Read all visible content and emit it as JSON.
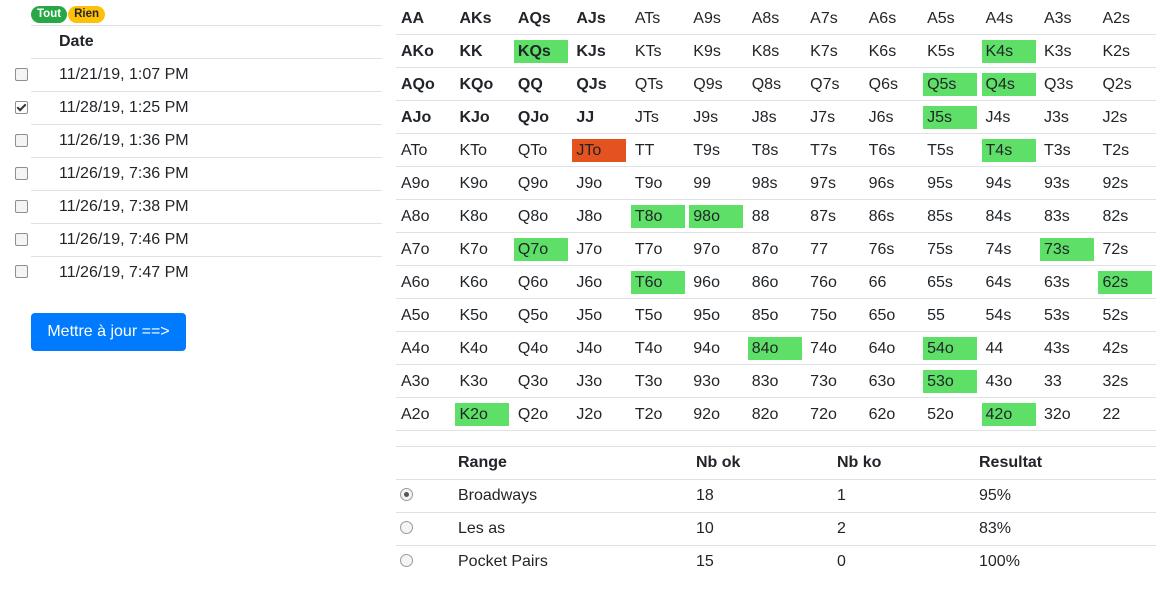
{
  "badges": {
    "all": "Tout",
    "none": "Rien"
  },
  "sessions": {
    "header": "Date",
    "rows": [
      {
        "date": "11/21/19, 1:07 PM",
        "checked": false
      },
      {
        "date": "11/28/19, 1:25 PM",
        "checked": true
      },
      {
        "date": "11/26/19, 1:36 PM",
        "checked": false
      },
      {
        "date": "11/26/19, 7:36 PM",
        "checked": false
      },
      {
        "date": "11/26/19, 7:38 PM",
        "checked": false
      },
      {
        "date": "11/26/19, 7:46 PM",
        "checked": false
      },
      {
        "date": "11/26/19, 7:47 PM",
        "checked": false
      }
    ]
  },
  "update_button": "Mettre à jour ==>",
  "colors": {
    "ok": "#5ee068",
    "ko": "#e2531f",
    "primary": "#007bff"
  },
  "grid": [
    [
      [
        "AA",
        "b"
      ],
      [
        "AKs",
        "b"
      ],
      [
        "AQs",
        "b"
      ],
      [
        "AJs",
        "b"
      ],
      [
        "ATs",
        ""
      ],
      [
        "A9s",
        ""
      ],
      [
        "A8s",
        ""
      ],
      [
        "A7s",
        ""
      ],
      [
        "A6s",
        ""
      ],
      [
        "A5s",
        ""
      ],
      [
        "A4s",
        ""
      ],
      [
        "A3s",
        ""
      ],
      [
        "A2s",
        ""
      ]
    ],
    [
      [
        "AKo",
        "b"
      ],
      [
        "KK",
        "b"
      ],
      [
        "KQs",
        "bg"
      ],
      [
        "KJs",
        "b"
      ],
      [
        "KTs",
        ""
      ],
      [
        "K9s",
        ""
      ],
      [
        "K8s",
        ""
      ],
      [
        "K7s",
        ""
      ],
      [
        "K6s",
        ""
      ],
      [
        "K5s",
        ""
      ],
      [
        "K4s",
        "g"
      ],
      [
        "K3s",
        ""
      ],
      [
        "K2s",
        ""
      ]
    ],
    [
      [
        "AQo",
        "b"
      ],
      [
        "KQo",
        "b"
      ],
      [
        "QQ",
        "b"
      ],
      [
        "QJs",
        "b"
      ],
      [
        "QTs",
        ""
      ],
      [
        "Q9s",
        ""
      ],
      [
        "Q8s",
        ""
      ],
      [
        "Q7s",
        ""
      ],
      [
        "Q6s",
        ""
      ],
      [
        "Q5s",
        "g"
      ],
      [
        "Q4s",
        "g"
      ],
      [
        "Q3s",
        ""
      ],
      [
        "Q2s",
        ""
      ]
    ],
    [
      [
        "AJo",
        "b"
      ],
      [
        "KJo",
        "b"
      ],
      [
        "QJo",
        "b"
      ],
      [
        "JJ",
        "b"
      ],
      [
        "JTs",
        ""
      ],
      [
        "J9s",
        ""
      ],
      [
        "J8s",
        ""
      ],
      [
        "J7s",
        ""
      ],
      [
        "J6s",
        ""
      ],
      [
        "J5s",
        "g"
      ],
      [
        "J4s",
        ""
      ],
      [
        "J3s",
        ""
      ],
      [
        "J2s",
        ""
      ]
    ],
    [
      [
        "ATo",
        ""
      ],
      [
        "KTo",
        ""
      ],
      [
        "QTo",
        ""
      ],
      [
        "JTo",
        "r"
      ],
      [
        "TT",
        ""
      ],
      [
        "T9s",
        ""
      ],
      [
        "T8s",
        ""
      ],
      [
        "T7s",
        ""
      ],
      [
        "T6s",
        ""
      ],
      [
        "T5s",
        ""
      ],
      [
        "T4s",
        "g"
      ],
      [
        "T3s",
        ""
      ],
      [
        "T2s",
        ""
      ]
    ],
    [
      [
        "A9o",
        ""
      ],
      [
        "K9o",
        ""
      ],
      [
        "Q9o",
        ""
      ],
      [
        "J9o",
        ""
      ],
      [
        "T9o",
        ""
      ],
      [
        "99",
        ""
      ],
      [
        "98s",
        ""
      ],
      [
        "97s",
        ""
      ],
      [
        "96s",
        ""
      ],
      [
        "95s",
        ""
      ],
      [
        "94s",
        ""
      ],
      [
        "93s",
        ""
      ],
      [
        "92s",
        ""
      ]
    ],
    [
      [
        "A8o",
        ""
      ],
      [
        "K8o",
        ""
      ],
      [
        "Q8o",
        ""
      ],
      [
        "J8o",
        ""
      ],
      [
        "T8o",
        "g"
      ],
      [
        "98o",
        "g"
      ],
      [
        "88",
        ""
      ],
      [
        "87s",
        ""
      ],
      [
        "86s",
        ""
      ],
      [
        "85s",
        ""
      ],
      [
        "84s",
        ""
      ],
      [
        "83s",
        ""
      ],
      [
        "82s",
        ""
      ]
    ],
    [
      [
        "A7o",
        ""
      ],
      [
        "K7o",
        ""
      ],
      [
        "Q7o",
        "g"
      ],
      [
        "J7o",
        ""
      ],
      [
        "T7o",
        ""
      ],
      [
        "97o",
        ""
      ],
      [
        "87o",
        ""
      ],
      [
        "77",
        ""
      ],
      [
        "76s",
        ""
      ],
      [
        "75s",
        ""
      ],
      [
        "74s",
        ""
      ],
      [
        "73s",
        "g"
      ],
      [
        "72s",
        ""
      ]
    ],
    [
      [
        "A6o",
        ""
      ],
      [
        "K6o",
        ""
      ],
      [
        "Q6o",
        ""
      ],
      [
        "J6o",
        ""
      ],
      [
        "T6o",
        "g"
      ],
      [
        "96o",
        ""
      ],
      [
        "86o",
        ""
      ],
      [
        "76o",
        ""
      ],
      [
        "66",
        ""
      ],
      [
        "65s",
        ""
      ],
      [
        "64s",
        ""
      ],
      [
        "63s",
        ""
      ],
      [
        "62s",
        "g"
      ]
    ],
    [
      [
        "A5o",
        ""
      ],
      [
        "K5o",
        ""
      ],
      [
        "Q5o",
        ""
      ],
      [
        "J5o",
        ""
      ],
      [
        "T5o",
        ""
      ],
      [
        "95o",
        ""
      ],
      [
        "85o",
        ""
      ],
      [
        "75o",
        ""
      ],
      [
        "65o",
        ""
      ],
      [
        "55",
        ""
      ],
      [
        "54s",
        ""
      ],
      [
        "53s",
        ""
      ],
      [
        "52s",
        ""
      ]
    ],
    [
      [
        "A4o",
        ""
      ],
      [
        "K4o",
        ""
      ],
      [
        "Q4o",
        ""
      ],
      [
        "J4o",
        ""
      ],
      [
        "T4o",
        ""
      ],
      [
        "94o",
        ""
      ],
      [
        "84o",
        "g"
      ],
      [
        "74o",
        ""
      ],
      [
        "64o",
        ""
      ],
      [
        "54o",
        "g"
      ],
      [
        "44",
        ""
      ],
      [
        "43s",
        ""
      ],
      [
        "42s",
        ""
      ]
    ],
    [
      [
        "A3o",
        ""
      ],
      [
        "K3o",
        ""
      ],
      [
        "Q3o",
        ""
      ],
      [
        "J3o",
        ""
      ],
      [
        "T3o",
        ""
      ],
      [
        "93o",
        ""
      ],
      [
        "83o",
        ""
      ],
      [
        "73o",
        ""
      ],
      [
        "63o",
        ""
      ],
      [
        "53o",
        "g"
      ],
      [
        "43o",
        ""
      ],
      [
        "33",
        ""
      ],
      [
        "32s",
        ""
      ]
    ],
    [
      [
        "A2o",
        ""
      ],
      [
        "K2o",
        "g"
      ],
      [
        "Q2o",
        ""
      ],
      [
        "J2o",
        ""
      ],
      [
        "T2o",
        ""
      ],
      [
        "92o",
        ""
      ],
      [
        "82o",
        ""
      ],
      [
        "72o",
        ""
      ],
      [
        "62o",
        ""
      ],
      [
        "52o",
        ""
      ],
      [
        "42o",
        "g"
      ],
      [
        "32o",
        ""
      ],
      [
        "22",
        ""
      ]
    ]
  ],
  "results": {
    "headers": [
      "Range",
      "Nb ok",
      "Nb ko",
      "Resultat"
    ],
    "rows": [
      {
        "range": "Broadways",
        "ok": "18",
        "ko": "1",
        "result": "95%",
        "selected": true
      },
      {
        "range": "Les as",
        "ok": "10",
        "ko": "2",
        "result": "83%",
        "selected": false
      },
      {
        "range": "Pocket Pairs",
        "ok": "15",
        "ko": "0",
        "result": "100%",
        "selected": false
      }
    ]
  }
}
